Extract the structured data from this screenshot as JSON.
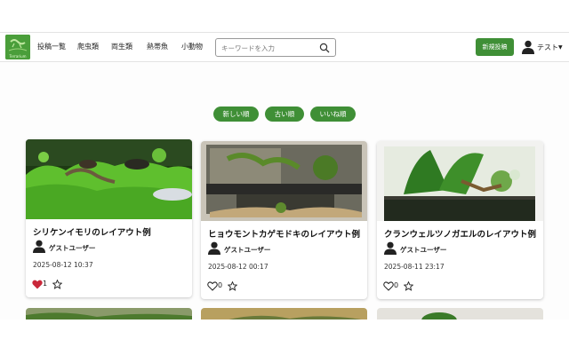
{
  "nav": {
    "logo_text": "Terrarium",
    "links": [
      "投稿一覧",
      "爬虫類",
      "両生類",
      "熱帯魚",
      "小動物"
    ],
    "search_placeholder": "キーワードを入力",
    "new_post": "新規投稿",
    "user_name": "テスト"
  },
  "sort": [
    "新しい順",
    "古い順",
    "いいね順"
  ],
  "posts": [
    {
      "title": "シリケンイモリのレイアウト例",
      "author": "ゲストユーザー",
      "date": "2025-08-12 10:37",
      "likes": "1",
      "liked": true
    },
    {
      "title": "ヒョウモントカゲモドキのレイアウト例",
      "author": "ゲストユーザー",
      "date": "2025-08-12 00:17",
      "likes": "0",
      "liked": false
    },
    {
      "title": "クランウェルツノガエルのレイアウト例",
      "author": "ゲストユーザー",
      "date": "2025-08-11 23:17",
      "likes": "0",
      "liked": false
    }
  ],
  "colors": {
    "accent": "#3f8f36",
    "liked": "#c9283a"
  }
}
